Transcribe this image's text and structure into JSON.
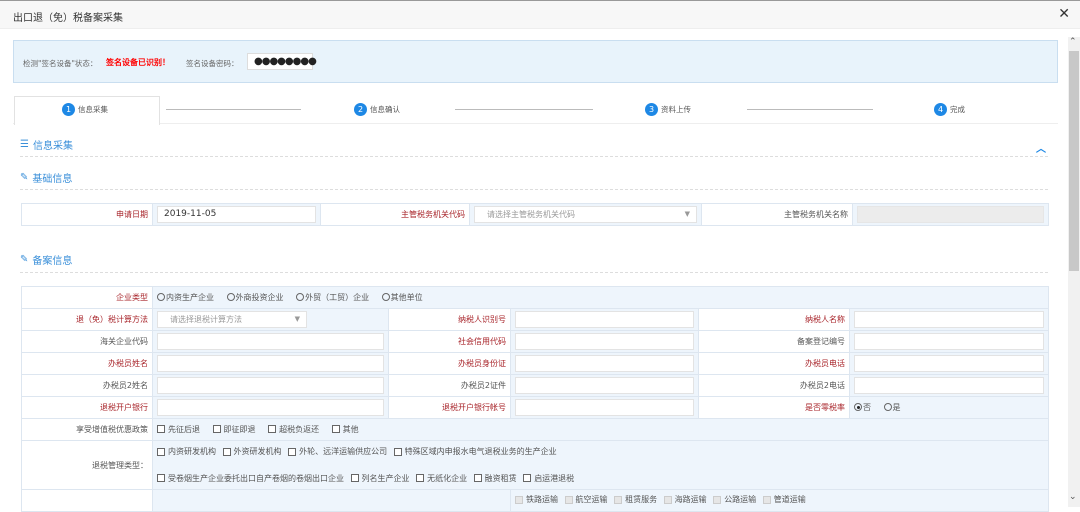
{
  "window": {
    "title": "出口退（免）税备案采集",
    "close": "✕"
  },
  "device": {
    "status_label": "检测\"签名设备\"状态：",
    "status_value": "签名设备已识别！",
    "password_label": "签名设备密码：",
    "password_value": "●●●●●●●●"
  },
  "steps": [
    {
      "num": "1",
      "label": "信息采集"
    },
    {
      "num": "2",
      "label": "信息确认"
    },
    {
      "num": "3",
      "label": "资料上传"
    },
    {
      "num": "4",
      "label": "完成"
    }
  ],
  "sections": {
    "collect": "信息采集",
    "basic": "基础信息",
    "filing": "备案信息"
  },
  "basic": {
    "date_label": "申请日期",
    "date_value": "2019-11-05",
    "org_code_label": "主管税务机关代码",
    "org_code_placeholder": "请选择主管税务机关代码",
    "org_name_label": "主管税务机关名称"
  },
  "filing": {
    "enterprise_type_label": "企业类型",
    "enterprise_types": [
      "内资生产企业",
      "外商投资企业",
      "外贸（工贸）企业",
      "其他单位"
    ],
    "method_label": "退（免）税计算方法",
    "method_placeholder": "请选择退税计算方法",
    "taxpayer_id_label": "纳税人识别号",
    "taxpayer_name_label": "纳税人名称",
    "customs_code_label": "海关企业代码",
    "credit_code_label": "社会信用代码",
    "record_no_label": "备案登记编号",
    "agent_name_label": "办税员姓名",
    "agent_id_label": "办税员身份证",
    "agent_phone_label": "办税员电话",
    "agent2_name_label": "办税员2姓名",
    "agent2_id_label": "办税员2证件",
    "agent2_phone_label": "办税员2电话",
    "bank_label": "退税开户银行",
    "bank_account_label": "退税开户银行帐号",
    "zero_rate_label": "是否零税率",
    "zero_rate_options": [
      "否",
      "是"
    ],
    "policy_label": "享受增值税优惠政策",
    "policies": [
      "先征后退",
      "即征即退",
      "超税负返还",
      "其他"
    ],
    "mgmt_label": "退税管理类型：",
    "mgmt_types_1": [
      "内资研发机构",
      "外资研发机构",
      "外轮、远洋运输供应公司",
      "特殊区域内申报水电气退税业务的生产企业"
    ],
    "mgmt_types_2": [
      "受卷烟生产企业委托出口自产卷烟的卷烟出口企业",
      "列名生产企业",
      "无纸化企业",
      "融资租赁",
      "启运港退税"
    ],
    "transport": [
      "铁路运输",
      "航空运输",
      "租赁服务",
      "海路运输",
      "公路运输",
      "管道运输"
    ]
  }
}
